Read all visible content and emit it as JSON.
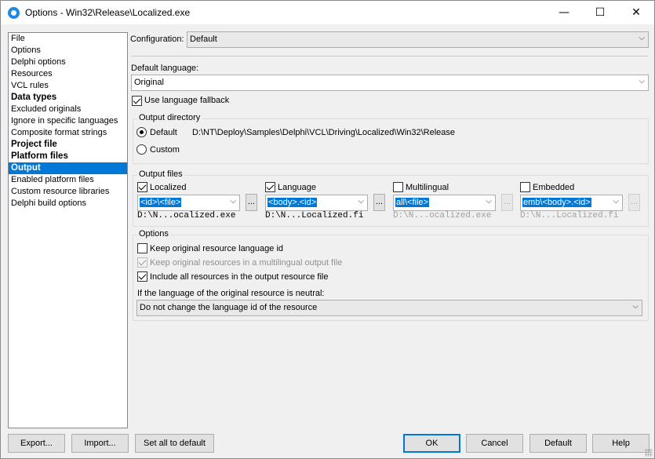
{
  "window": {
    "title": "Options - Win32\\Release\\Localized.exe",
    "minimize_glyph": "—",
    "maximize_glyph": "☐",
    "close_glyph": "✕"
  },
  "nav": {
    "items": [
      {
        "label": "File",
        "bold": false,
        "selected": false
      },
      {
        "label": "Options",
        "bold": false,
        "selected": false
      },
      {
        "label": "Delphi options",
        "bold": false,
        "selected": false
      },
      {
        "label": "Resources",
        "bold": false,
        "selected": false
      },
      {
        "label": "VCL rules",
        "bold": false,
        "selected": false
      },
      {
        "label": "Data types",
        "bold": true,
        "selected": false
      },
      {
        "label": "Excluded originals",
        "bold": false,
        "selected": false
      },
      {
        "label": "Ignore in specific languages",
        "bold": false,
        "selected": false
      },
      {
        "label": "Composite format strings",
        "bold": false,
        "selected": false
      },
      {
        "label": "Project file",
        "bold": true,
        "selected": false
      },
      {
        "label": "Platform files",
        "bold": true,
        "selected": false
      },
      {
        "label": "Output",
        "bold": true,
        "selected": true
      },
      {
        "label": "Enabled platform files",
        "bold": false,
        "selected": false
      },
      {
        "label": "Custom resource libraries",
        "bold": false,
        "selected": false
      },
      {
        "label": "Delphi build options",
        "bold": false,
        "selected": false
      }
    ]
  },
  "configuration": {
    "label": "Configuration:",
    "value": "Default"
  },
  "default_language": {
    "label": "Default language:",
    "value": "Original"
  },
  "use_fallback": {
    "label": "Use language fallback",
    "checked": true
  },
  "output_directory": {
    "title": "Output directory",
    "default_label": "Default",
    "default_path": "D:\\NT\\Deploy\\Samples\\Delphi\\VCL\\Driving\\Localized\\Win32\\Release",
    "custom_label": "Custom",
    "selected": "Default"
  },
  "output_files": {
    "title": "Output files",
    "columns": [
      {
        "label": "Localized",
        "checked": true,
        "enabled": true,
        "pattern": "<id>\\<file>",
        "path": "D:\\N...ocalized.exe"
      },
      {
        "label": "Language",
        "checked": true,
        "enabled": true,
        "pattern": "<body>.<id>",
        "path": "D:\\N...Localized.fi"
      },
      {
        "label": "Multilingual",
        "checked": false,
        "enabled": false,
        "pattern": "all\\<file>",
        "path": "D:\\N...ocalized.exe"
      },
      {
        "label": "Embedded",
        "checked": false,
        "enabled": false,
        "pattern": "emb\\<body>.<id>",
        "path": "D:\\N...Localized.fi"
      }
    ],
    "browse_label": "..."
  },
  "options": {
    "title": "Options",
    "keep_lang_id": {
      "label": "Keep original resource language id",
      "checked": false,
      "enabled": true
    },
    "keep_multilingual": {
      "label": "Keep original resources in a multilingual output file",
      "checked": true,
      "enabled": false
    },
    "include_all": {
      "label": "Include all resources in the output resource file",
      "checked": true,
      "enabled": true
    },
    "neutral_label": "If the language of the original resource is neutral:",
    "neutral_value": "Do not change the language id of the resource"
  },
  "buttons": {
    "export": "Export...",
    "import": "Import...",
    "set_all_default": "Set all to default",
    "ok": "OK",
    "cancel": "Cancel",
    "default": "Default",
    "help": "Help"
  },
  "colors": {
    "accent": "#0078d7",
    "window_bg": "#f0f0f0"
  }
}
